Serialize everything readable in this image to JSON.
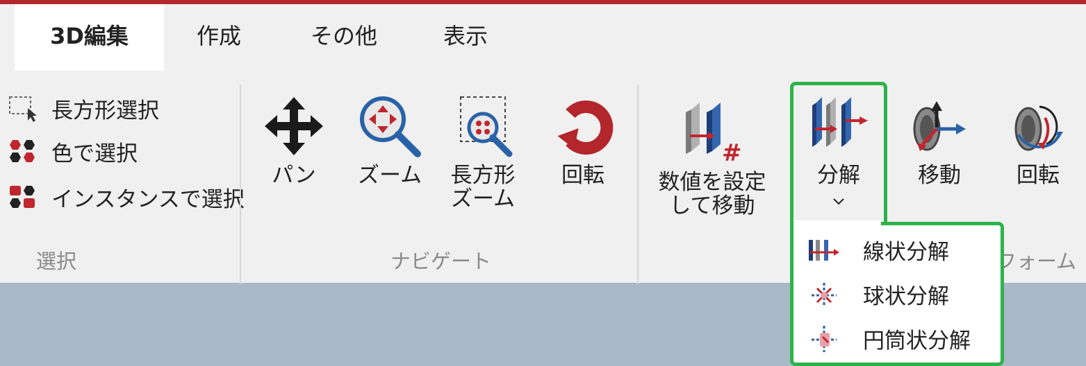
{
  "tabs": [
    {
      "label": "3D編集",
      "active": true
    },
    {
      "label": "作成",
      "active": false
    },
    {
      "label": "その他",
      "active": false
    },
    {
      "label": "表示",
      "active": false
    }
  ],
  "selection": {
    "items": [
      {
        "label": "長方形選択",
        "icon": "rect-select-icon"
      },
      {
        "label": "色で選択",
        "icon": "color-select-icon"
      },
      {
        "label": "インスタンスで選択",
        "icon": "instance-select-icon"
      }
    ],
    "group_label": "選択"
  },
  "navigate": {
    "pan": "パン",
    "zoom": "ズーム",
    "rect_zoom_1": "長方形",
    "rect_zoom_2": "ズーム",
    "rotate": "回転",
    "group_label": "ナビゲート"
  },
  "transform": {
    "numeric_move_1": "数値を設定",
    "numeric_move_2": "して移動",
    "explode": "分解",
    "move": "移動",
    "rotate": "回転",
    "group_label_partial": "フォーム"
  },
  "explode_menu": {
    "items": [
      "線状分解",
      "球状分解",
      "円筒状分解"
    ]
  },
  "colors": {
    "accent_red": "#b3262c",
    "highlight_green": "#2db24a",
    "viewport_bg": "#a9b9c8",
    "ribbon_bg": "#f0f0f0"
  }
}
